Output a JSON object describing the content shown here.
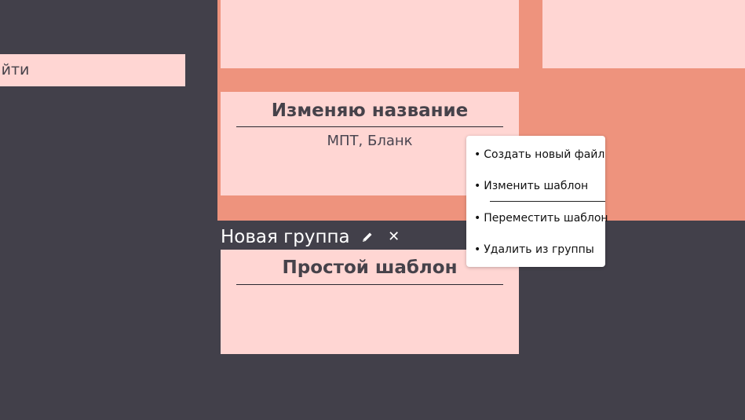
{
  "search": {
    "label": "айти"
  },
  "group_top": {
    "cards": [
      {
        "title": "Изменяю название",
        "subtitle": "МПТ, Бланк"
      }
    ]
  },
  "group_new": {
    "name": "Новая группа",
    "edit_icon": "pencil-icon",
    "close_icon": "close-icon",
    "close_glyph": "✕",
    "cards": [
      {
        "title": "Простой шаблон"
      }
    ]
  },
  "context_menu": {
    "bullet": "•",
    "items": [
      {
        "label": "Создать новый файл"
      },
      {
        "label": "Изменить шаблон"
      },
      {
        "label": "Переместить шаблон"
      },
      {
        "label": "Удалить из группы"
      }
    ]
  },
  "colors": {
    "background": "#42404a",
    "group_background": "#ee937d",
    "card_background": "#ffd6d3",
    "menu_background": "#ffffff",
    "text_dark": "#46424a"
  }
}
